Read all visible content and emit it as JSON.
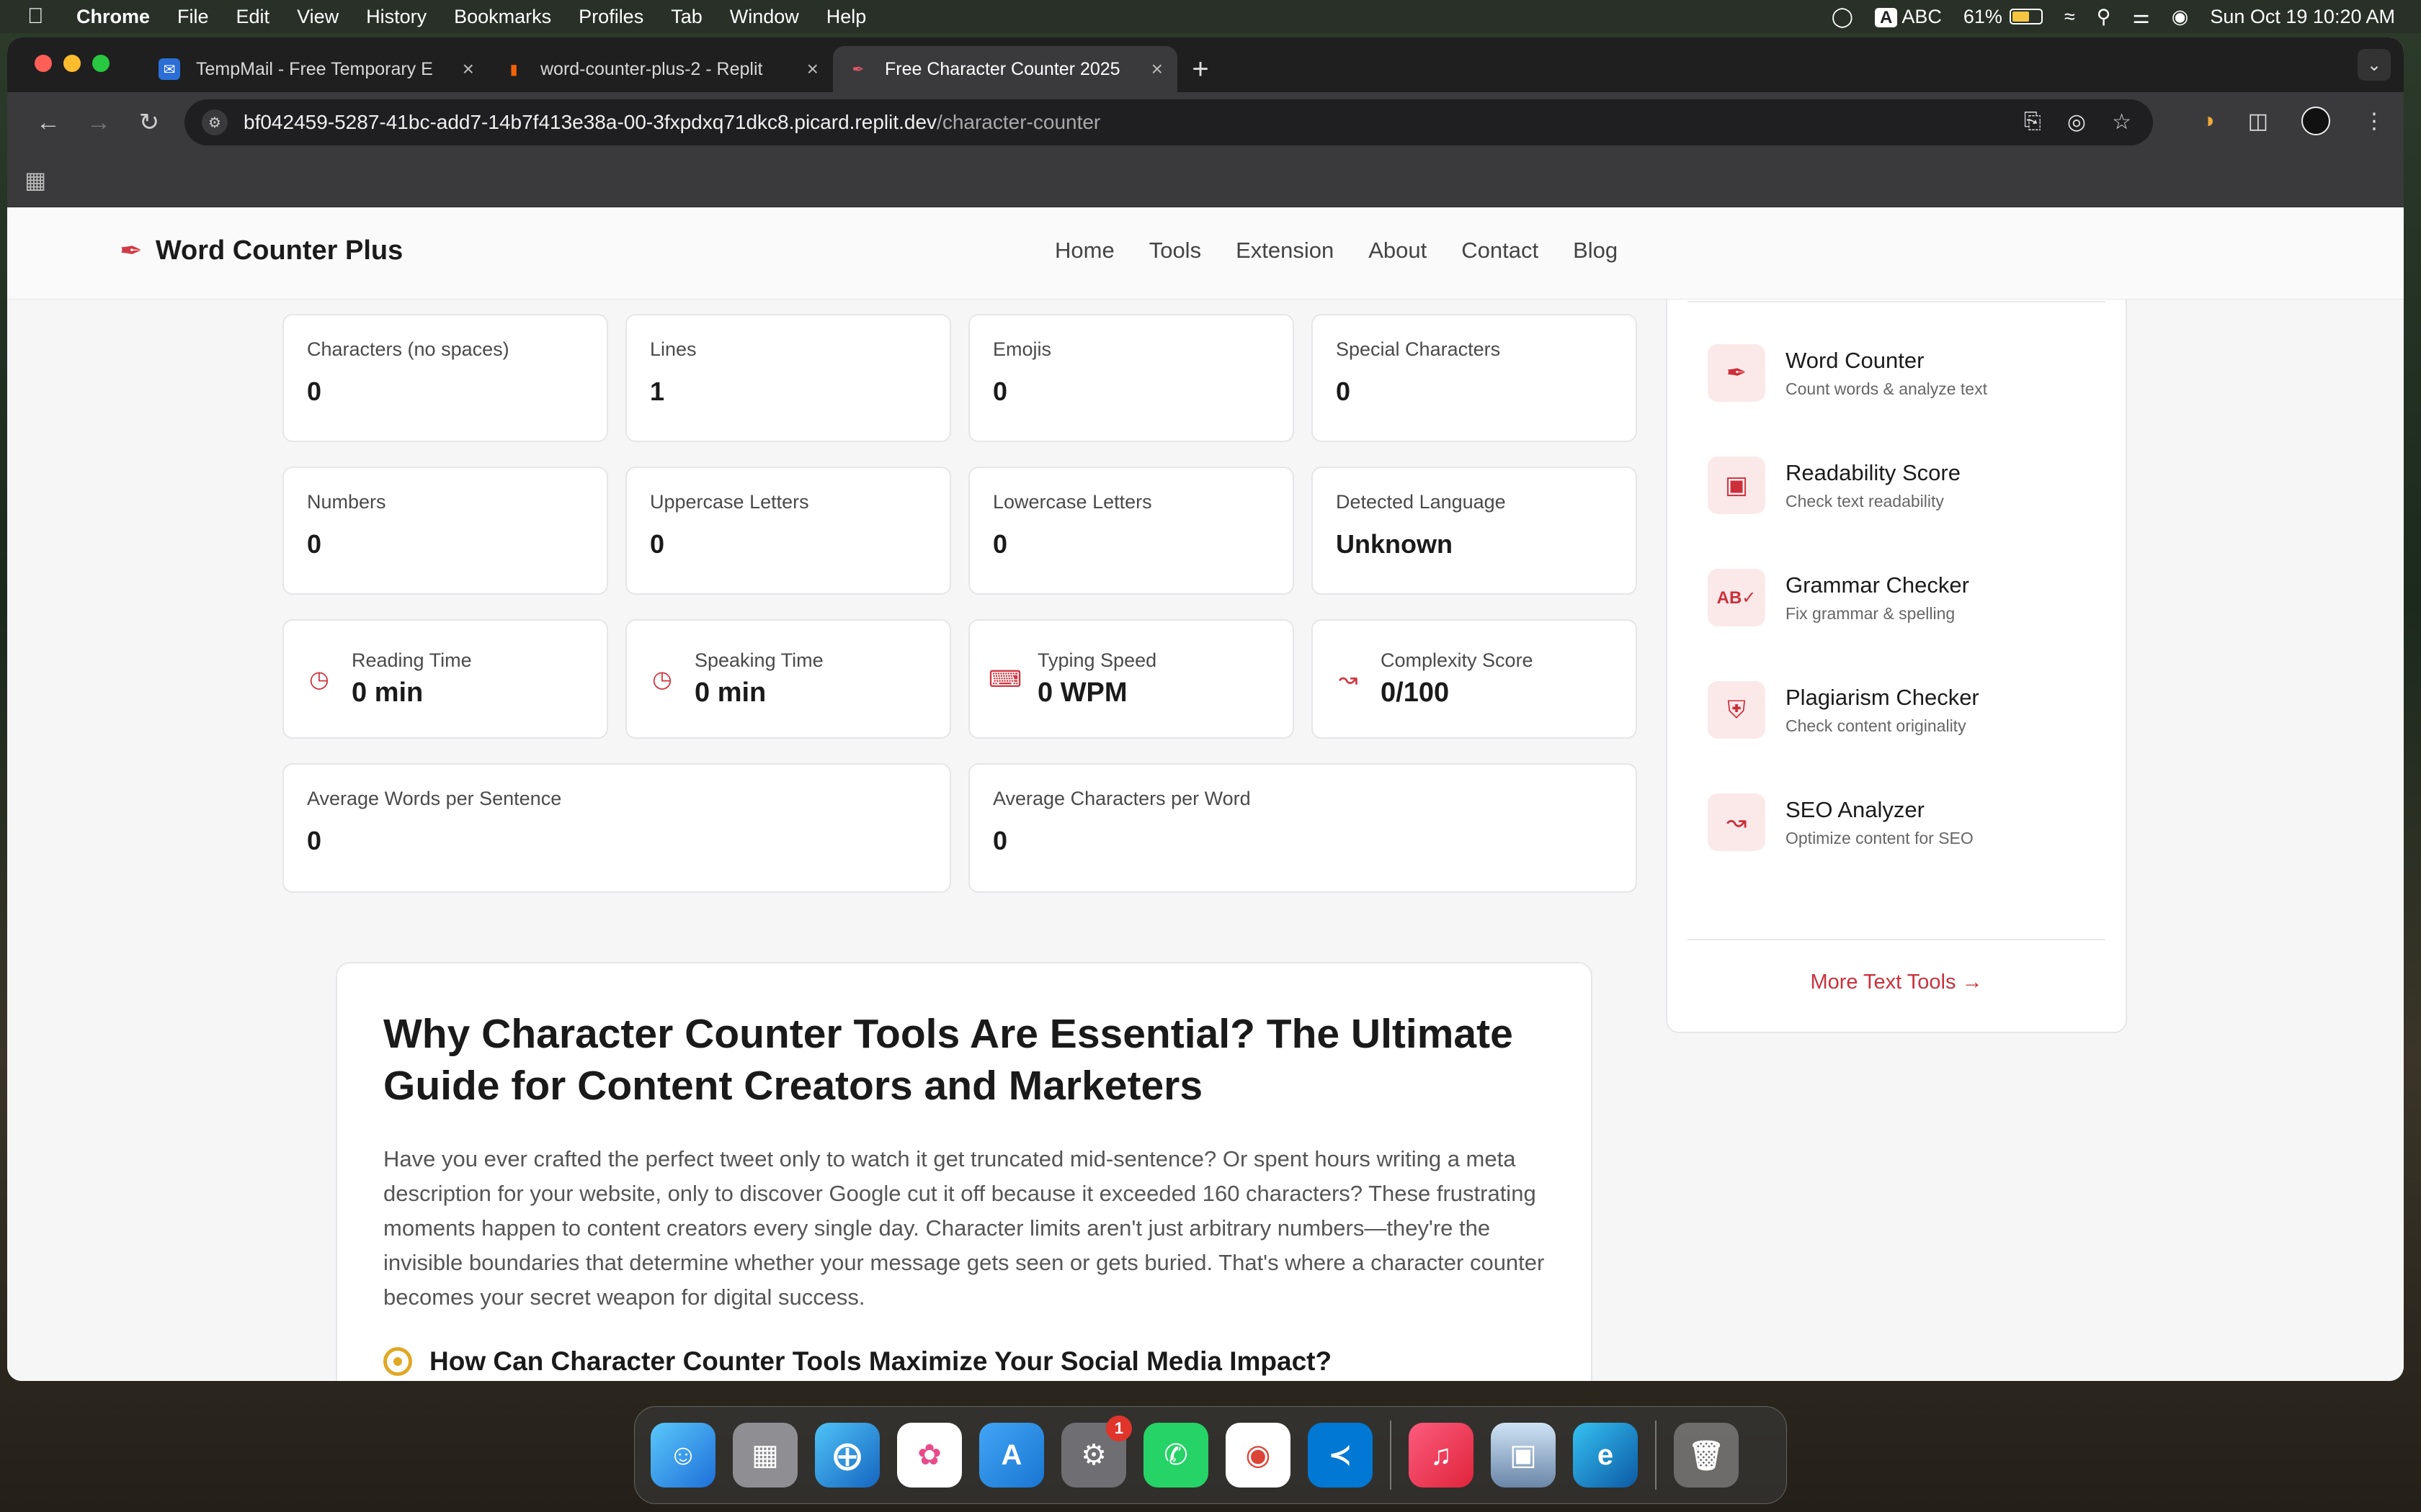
{
  "menubar": {
    "app": "Chrome",
    "items": [
      "File",
      "Edit",
      "View",
      "History",
      "Bookmarks",
      "Profiles",
      "Tab",
      "Window",
      "Help"
    ],
    "input_source": "A",
    "input_label": "ABC",
    "battery": "61%",
    "battery_level": 0.61,
    "datetime": "Sun Oct 19  10:20 AM"
  },
  "browser": {
    "tabs": [
      {
        "title": "TempMail - Free Temporary E",
        "icon": "mail-icon",
        "active": false
      },
      {
        "title": "word-counter-plus-2 - Replit",
        "icon": "replit-icon",
        "active": false
      },
      {
        "title": "Free Character Counter 2025",
        "icon": "pen-icon",
        "active": true
      }
    ],
    "url_host": "bf042459-5287-41bc-add7-14b7f413e38a-00-3fxpdxq71dkc8.picard.replit.dev",
    "url_path": "/character-counter"
  },
  "site": {
    "brand": "Word Counter Plus",
    "nav": [
      "Home",
      "Tools",
      "Extension",
      "About",
      "Contact",
      "Blog"
    ]
  },
  "stats": {
    "row1": [
      {
        "label": "Characters (no spaces)",
        "value": "0"
      },
      {
        "label": "Lines",
        "value": "1"
      },
      {
        "label": "Emojis",
        "value": "0"
      },
      {
        "label": "Special Characters",
        "value": "0"
      }
    ],
    "row2": [
      {
        "label": "Numbers",
        "value": "0"
      },
      {
        "label": "Uppercase Letters",
        "value": "0"
      },
      {
        "label": "Lowercase Letters",
        "value": "0"
      },
      {
        "label": "Detected Language",
        "value": "Unknown"
      }
    ],
    "row3": [
      {
        "label": "Reading Time",
        "value": "0 min",
        "icon": "clock-icon"
      },
      {
        "label": "Speaking Time",
        "value": "0 min",
        "icon": "clock-icon"
      },
      {
        "label": "Typing Speed",
        "value": "0 WPM",
        "icon": "keyboard-icon"
      },
      {
        "label": "Complexity Score",
        "value": "0/100",
        "icon": "chart-icon"
      }
    ],
    "row4": [
      {
        "label": "Average Words per Sentence",
        "value": "0"
      },
      {
        "label": "Average Characters per Word",
        "value": "0"
      }
    ]
  },
  "sidebar": {
    "tools": [
      {
        "name": "Word Counter",
        "desc": "Count words & analyze text",
        "icon": "pen-icon"
      },
      {
        "name": "Readability Score",
        "desc": "Check text readability",
        "icon": "book-icon"
      },
      {
        "name": "Grammar Checker",
        "desc": "Fix grammar & spelling",
        "icon": "spellcheck-icon"
      },
      {
        "name": "Plagiarism Checker",
        "desc": "Check content originality",
        "icon": "shield-icon"
      },
      {
        "name": "SEO Analyzer",
        "desc": "Optimize content for SEO",
        "icon": "trend-icon"
      }
    ],
    "more": "More Text Tools →"
  },
  "article": {
    "title": "Why Character Counter Tools Are Essential? The Ultimate Guide for Content Creators and Marketers",
    "body": "Have you ever crafted the perfect tweet only to watch it get truncated mid-sentence? Or spent hours writing a meta description for your website, only to discover Google cut it off because it exceeded 160 characters? These frustrating moments happen to content creators every single day. Character limits aren't just arbitrary numbers—they're the invisible boundaries that determine whether your message gets seen or gets buried. That's where a character counter becomes your secret weapon for digital success.",
    "subheading": "How Can Character Counter Tools Maximize Your Social Media Impact?"
  },
  "dock": {
    "apps": [
      "finder",
      "launchpad",
      "safari",
      "photos",
      "app-store",
      "system-settings",
      "whatsapp",
      "chrome",
      "vscode",
      "music",
      "preview",
      "edge",
      "trash"
    ],
    "settings_badge": "1"
  },
  "colors": {
    "accent": "#cf3640",
    "accent_bg": "#fbe9ea",
    "gold": "#e0a823"
  }
}
